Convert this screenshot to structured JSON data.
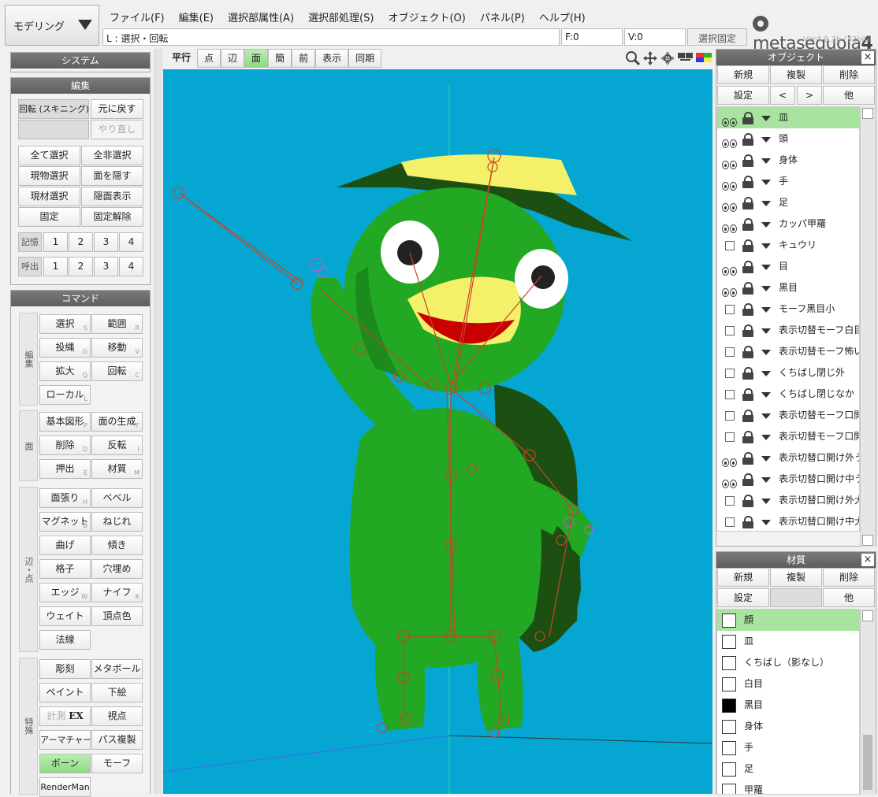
{
  "mode": {
    "label": "モデリング"
  },
  "menu": [
    "ファイル(F)",
    "編集(E)",
    "選択部属性(A)",
    "選択部処理(S)",
    "オブジェクト(O)",
    "パネル(P)",
    "ヘルプ(H)"
  ],
  "status": {
    "hint": "L : 選択・回転",
    "face": "F:0",
    "vertex": "V:0",
    "fixed": "選択固定"
  },
  "logo": {
    "brand": "metasequoia",
    "number": "4",
    "version": "Ver4.8.3b (32bit)"
  },
  "panels": {
    "system": "システム",
    "edit": "編集",
    "command": "コマンド"
  },
  "edit_buttons": {
    "rotate_skin": "回転 (スキニング)",
    "undo": "元に戻す",
    "redo": "やり直し",
    "select_all": "全て選択",
    "deselect_all": "全非選択",
    "select_obj": "現物選択",
    "hide_face": "面を隠す",
    "select_mat": "現材選択",
    "show_hidden": "隠面表示",
    "fix": "固定",
    "unfix": "固定解除",
    "memory": "記憶",
    "recall": "呼出",
    "nums": [
      "1",
      "2",
      "3",
      "4"
    ]
  },
  "command_groups": {
    "edit": "編集",
    "face": "面",
    "edge_vertex": "辺・点",
    "special": "特殊"
  },
  "commands": {
    "select": "選択",
    "range": "範囲",
    "lasso": "投縄",
    "move": "移動",
    "scale": "拡大",
    "rotate": "回転",
    "local": "ローカル",
    "primitive": "基本図形",
    "face_gen": "面の生成",
    "delete": "削除",
    "flip": "反転",
    "extrude": "押出",
    "material": "材質",
    "face_stretch": "面張り",
    "bevel": "ベベル",
    "magnet": "マグネット",
    "twist": "ねじれ",
    "bend": "曲げ",
    "slant": "傾き",
    "lattice": "格子",
    "fill_hole": "穴埋め",
    "edge": "エッジ",
    "knife": "ナイフ",
    "weight": "ウェイト",
    "vertex_color": "頂点色",
    "normal": "法線",
    "sculpt": "彫刻",
    "metaball": "メタボール",
    "paint": "ペイント",
    "underlay": "下絵",
    "measure": "計測",
    "ex": "EX",
    "viewpoint": "視点",
    "armature": "アーマチャー",
    "path_copy": "パス複製",
    "bone": "ボーン",
    "morph": "モーフ",
    "renderman": "RenderMan"
  },
  "command_keys": {
    "select": "S",
    "range": "R",
    "lasso": "G",
    "move": "V",
    "scale": "Q",
    "rotate": "C",
    "local": "L",
    "primitive": "P",
    "face_gen": "F",
    "delete": "D",
    "flip": "I",
    "extrude": "E",
    "material": "M",
    "face_stretch": "H",
    "magnet": "B",
    "edge": "W",
    "knife": "K"
  },
  "view_toolbar": [
    "平行",
    "点",
    "辺",
    "面",
    "簡",
    "前",
    "表示",
    "同期"
  ],
  "object_panel": {
    "title": "オブジェクト",
    "new": "新規",
    "duplicate": "複製",
    "delete": "削除",
    "settings": "設定",
    "prev": "<",
    "next": ">",
    "other": "他",
    "items": [
      {
        "name": "皿",
        "visible": true,
        "selected": true
      },
      {
        "name": "頭",
        "visible": true
      },
      {
        "name": "身体",
        "visible": true
      },
      {
        "name": "手",
        "visible": true
      },
      {
        "name": "足",
        "visible": true
      },
      {
        "name": "カッパ甲羅",
        "visible": true
      },
      {
        "name": "キュウリ",
        "visible": false
      },
      {
        "name": "目",
        "visible": true
      },
      {
        "name": "黒目",
        "visible": true
      },
      {
        "name": "モーフ黒目小",
        "visible": false
      },
      {
        "name": "表示切替モーフ白目",
        "visible": false
      },
      {
        "name": "表示切替モーフ怖い",
        "visible": false
      },
      {
        "name": "くちばし閉じ外",
        "visible": false
      },
      {
        "name": "くちばし閉じなか",
        "visible": false
      },
      {
        "name": "表示切替モーフ口開",
        "visible": false
      },
      {
        "name": "表示切替モーフ口開",
        "visible": false
      },
      {
        "name": "表示切替口開け外う",
        "visible": true
      },
      {
        "name": "表示切替口開け中う",
        "visible": true
      },
      {
        "name": "表示切替口開け外大",
        "visible": false
      },
      {
        "name": "表示切替口開け中大",
        "visible": false
      }
    ]
  },
  "material_panel": {
    "title": "材質",
    "new": "新規",
    "duplicate": "複製",
    "delete": "削除",
    "settings": "設定",
    "other": "他",
    "items": [
      {
        "name": "顔",
        "color": "#ffffff",
        "selected": true
      },
      {
        "name": "皿",
        "color": "#ffffff"
      },
      {
        "name": "くちばし（影なし）",
        "color": "#ffffff"
      },
      {
        "name": "白目",
        "color": "#ffffff"
      },
      {
        "name": "黒目",
        "color": "#000000"
      },
      {
        "name": "身体",
        "color": "#ffffff"
      },
      {
        "name": "手",
        "color": "#ffffff"
      },
      {
        "name": "足",
        "color": "#ffffff"
      },
      {
        "name": "甲羅",
        "color": "#ffffff"
      }
    ]
  },
  "colors": {
    "viewport_bg": "#06a6d2",
    "body": "#22a822",
    "shell": "#1c4f12",
    "beak": "#f4f06a",
    "mouth": "#c80000",
    "bone": "#c8452a",
    "accent_green": "#a8e4a0"
  }
}
